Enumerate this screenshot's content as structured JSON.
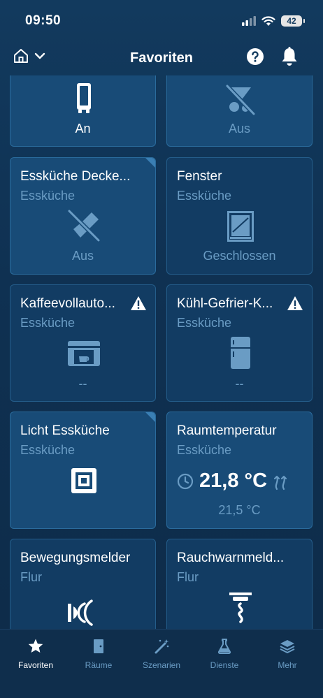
{
  "status_bar": {
    "time": "09:50",
    "battery": "42"
  },
  "header": {
    "title": "Favoriten"
  },
  "tiles": [
    {
      "status": "An"
    },
    {
      "status": "Aus"
    },
    {
      "title": "Essküche Decke...",
      "room": "Essküche",
      "status": "Aus",
      "icon": "ceiling-lamp-off-icon"
    },
    {
      "title": "Fenster",
      "room": "Essküche",
      "status": "Geschlossen",
      "icon": "window-icon"
    },
    {
      "title": "Kaffeevollauto...",
      "room": "Essküche",
      "status": "--",
      "icon": "coffee-machine-icon",
      "warning": true
    },
    {
      "title": "Kühl-Gefrier-K...",
      "room": "Essküche",
      "status": "--",
      "icon": "fridge-icon",
      "warning": true
    },
    {
      "title": "Licht Essküche",
      "room": "Essküche",
      "icon": "light-switch-icon"
    },
    {
      "title": "Raumtemperatur",
      "room": "Essküche",
      "temperature": "21,8 °C",
      "setpoint": "21,5 °C"
    },
    {
      "title": "Bewegungsmelder",
      "room": "Flur",
      "icon": "motion-sensor-icon"
    },
    {
      "title": "Rauchwarnmeld...",
      "room": "Flur",
      "icon": "smoke-detector-icon"
    }
  ],
  "tabbar": {
    "items": [
      {
        "label": "Favoriten",
        "icon": "star-icon",
        "active": true
      },
      {
        "label": "Räume",
        "icon": "door-icon"
      },
      {
        "label": "Szenarien",
        "icon": "magic-wand-icon"
      },
      {
        "label": "Dienste",
        "icon": "flask-icon"
      },
      {
        "label": "Mehr",
        "icon": "layers-icon"
      }
    ]
  },
  "colors": {
    "background": "#123a5e",
    "tile": "#184b77",
    "accent_text": "#6a9cc4"
  }
}
